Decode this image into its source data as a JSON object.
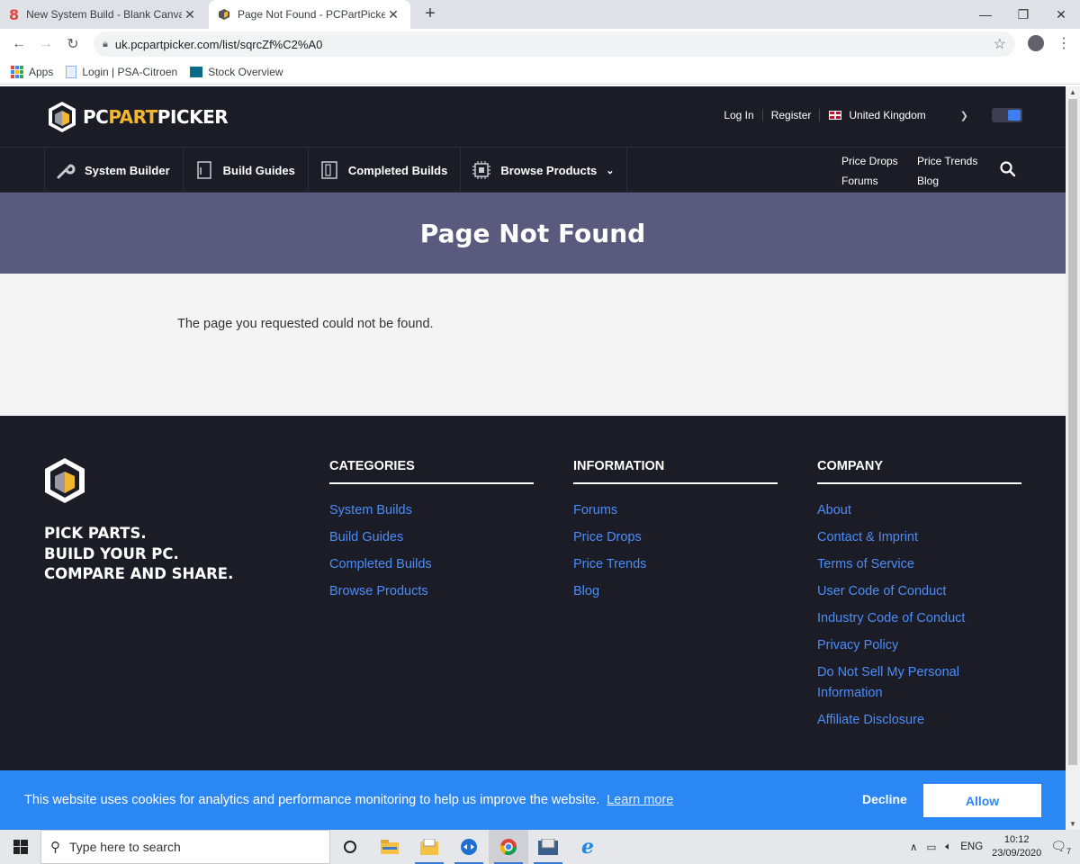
{
  "browser": {
    "tabs": [
      {
        "title": "New System Build - Blank Canvas",
        "active": false
      },
      {
        "title": "Page Not Found - PCPartPicker",
        "active": true
      }
    ],
    "url": "uk.pcpartpicker.com/list/sqrcZf%C2%A0",
    "bookmarks": [
      "Apps",
      "Login | PSA-Citroen",
      "Stock Overview"
    ]
  },
  "site": {
    "logo_part1": "PC",
    "logo_part2": "PART",
    "logo_part3": "PICKER",
    "header": {
      "login": "Log In",
      "register": "Register",
      "country": "United Kingdom"
    },
    "nav": [
      {
        "label": "System Builder",
        "icon": "wrench-icon"
      },
      {
        "label": "Build Guides",
        "icon": "guide-icon"
      },
      {
        "label": "Completed Builds",
        "icon": "case-icon"
      },
      {
        "label": "Browse Products",
        "icon": "chip-icon"
      }
    ],
    "nav_extra": [
      "Price Drops",
      "Price Trends",
      "Forums",
      "Blog"
    ],
    "page_title": "Page Not Found",
    "message": "The page you requested could not be found."
  },
  "footer": {
    "tagline": [
      "PICK PARTS.",
      "BUILD YOUR PC.",
      "COMPARE AND SHARE."
    ],
    "categories": {
      "heading": "CATEGORIES",
      "links": [
        "System Builds",
        "Build Guides",
        "Completed Builds",
        "Browse Products"
      ]
    },
    "information": {
      "heading": "INFORMATION",
      "links": [
        "Forums",
        "Price Drops",
        "Price Trends",
        "Blog"
      ]
    },
    "company": {
      "heading": "COMPANY",
      "links": [
        "About",
        "Contact & Imprint",
        "Terms of Service",
        "User Code of Conduct",
        "Industry Code of Conduct",
        "Privacy Policy",
        "Do Not Sell My Personal Information",
        "Affiliate Disclosure"
      ]
    }
  },
  "cookie": {
    "message": "This website uses cookies for analytics and performance monitoring to help us improve the website.",
    "learn_more": "Learn more",
    "decline": "Decline",
    "allow": "Allow"
  },
  "taskbar": {
    "search_placeholder": "Type here to search",
    "language": "ENG",
    "time": "10:12",
    "date": "23/09/2020",
    "notification_count": "7"
  },
  "colors": {
    "header_bg": "#1b1c26",
    "banner_bg": "#595a7d",
    "link_blue": "#4b8df8",
    "logo_accent": "#f0b72f",
    "cookie_bg": "#2b87f3"
  }
}
